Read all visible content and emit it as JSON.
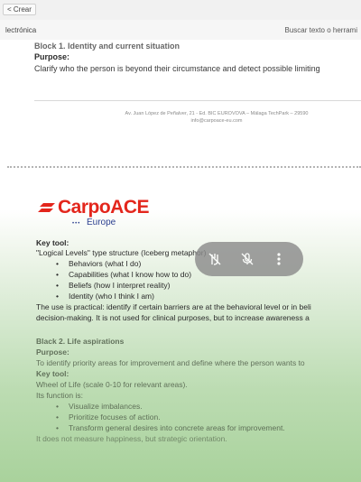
{
  "toolbar": {
    "back_label": "< Crear"
  },
  "subbar": {
    "left_label": "lectrónica",
    "search_label": "Buscar texto o herrami"
  },
  "page1": {
    "cut_title": "Block 1. Identity and current situation",
    "purpose_label": "Purpose:",
    "purpose_text": "Clarify who the person is beyond their circumstance and detect possible limiting",
    "address_line1": "Av. Juan López de Peñalver, 21 - Ed. BIC EUROVOVA – Málaga TechPark – 29590",
    "address_line2": "info@carpoace-eu.com"
  },
  "logo": {
    "name": "CarpoACE",
    "sub": "Europe",
    "dots": "•••"
  },
  "block1": {
    "key_tool_label": "Key tool:",
    "key_tool_text": "\"Logical Levels\" type structure (Iceberg metaphor)",
    "bullets": [
      "Behaviors (what I do)",
      "Capabilities (what I know how to do)",
      "Beliefs (how I interpret reality)",
      "Identity (who I think I am)"
    ],
    "use_line1": "The use is practical: identify if certain barriers are at the behavioral level or in beli",
    "use_line2": "decision-making. It is not used for clinical purposes, but to increase awareness a"
  },
  "block2": {
    "title": "Black 2. Life aspirations",
    "purpose_label": "Purpose:",
    "purpose_text": "To identify priority areas for improvement and define where the person wants to",
    "key_tool_label": "Key tool:",
    "key_tool_text": "Wheel of Life (scale 0-10 for relevant areas).",
    "function_label": "Its function is:",
    "bullets": [
      "Visualize imbalances.",
      "Prioritize focuses of action.",
      "Transform general desires into concrete areas for improvement."
    ],
    "closing": "It does not measure happiness, but strategic orientation."
  },
  "overlay": {
    "icons": [
      "hand-off-icon",
      "mic-off-icon",
      "more-vertical-icon"
    ]
  },
  "colors": {
    "brand_red": "#e3261c",
    "brand_blue": "#2b3f8f",
    "tint_green": "#a9d29c"
  }
}
